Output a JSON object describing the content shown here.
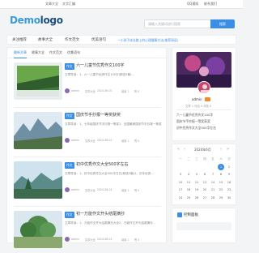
{
  "topbar": {
    "links_left": [
      "文章大全",
      "文字汇编"
    ],
    "links_right": [
      "QQ通知",
      "联系我们"
    ]
  },
  "logo": {
    "part1": "Demo",
    "part2": "logo"
  },
  "search": {
    "placeholder": "请输入关键词进行搜索",
    "button": "搜索"
  },
  "nav": {
    "items": [
      "关注推荐",
      "故事大全",
      "作文范文",
      "优美语句"
    ],
    "notice": "一小孩子成长路上的心理健康方法(推荐阅读)"
  },
  "tabs": [
    "最新文章",
    "故事大全",
    "作文范文",
    "优美语句"
  ],
  "articles": [
    {
      "category": "作文",
      "title": "六一儿童节优秀作文100字",
      "summary": "文章导读：1、六一儿童节优秀作文100字(精选5篇)...",
      "author": "admin",
      "channel": "文章大全",
      "date": "2024-06-01",
      "views": "阅读 1",
      "likes": "赞 0"
    },
    {
      "category": "作文",
      "title": "国庆节手抄报一等奖获奖",
      "summary": "文章导读：1、七年级国庆节手抄报一等奖2、全国最美国庆节手抄报一等奖...",
      "author": "admin",
      "channel": "文章大全",
      "date": "2024-06-01",
      "views": "阅读 1",
      "likes": "赞 0"
    },
    {
      "category": "作文",
      "title": "初中优秀作文大全500字左右",
      "summary": "文章导读：1、初中优秀作文大全500字左右(精选5篇)2、初中优秀...",
      "author": "admin",
      "channel": "文章大全",
      "date": "2024-06-01",
      "views": "阅读 1",
      "likes": "赞 0"
    },
    {
      "category": "作文",
      "title": "初一万能作文开头结尾摘抄",
      "summary": "文章导读：1、万能作文开头结尾摘抄大全2、万能作文开头结尾摘抄...",
      "author": "admin",
      "channel": "文章大全",
      "date": "2024-06-01",
      "views": "阅读 1",
      "likes": "赞 0"
    }
  ],
  "profile": {
    "name": "admin",
    "stats": "文章 1 评论 0 浏览 0",
    "links": [
      "六一儿童节优秀作文100字",
      "国庆节手抄报一等奖获奖",
      "初中优秀作文大全500字左右"
    ]
  },
  "calendar": {
    "month": "2024年6月",
    "weekdays": [
      "一",
      "二",
      "三",
      "四",
      "五",
      "六",
      "日"
    ],
    "weeks": [
      [
        "",
        "",
        "",
        "",
        "",
        "1",
        "2"
      ],
      [
        "3",
        "4",
        "5",
        "6",
        "7",
        "8",
        "9"
      ],
      [
        "10",
        "11",
        "12",
        "13",
        "14",
        "15",
        "16"
      ],
      [
        "17",
        "18",
        "19",
        "20",
        "21",
        "22",
        "23"
      ],
      [
        "24",
        "25",
        "26",
        "27",
        "28",
        "29",
        "30"
      ]
    ],
    "today": "1"
  },
  "control": {
    "title": "控制面板"
  },
  "colors": {
    "accent": "#3a8ee6",
    "logo": "#3a9bd5",
    "badge": "#f08c2b"
  }
}
